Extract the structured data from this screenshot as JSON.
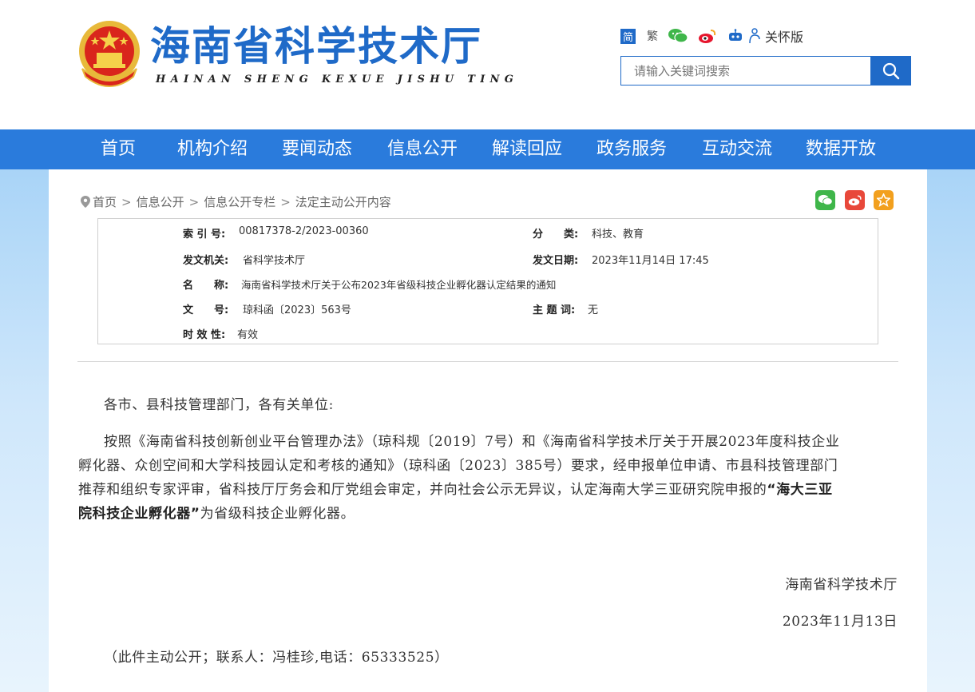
{
  "header": {
    "title": "海南省科学技术厅",
    "pinyin": "HAINAN SHENG KEXUE JISHU TING",
    "tools": {
      "simplified": "简",
      "traditional": "繁",
      "care": "关怀版"
    },
    "search_placeholder": "请输入关键词搜索"
  },
  "nav": [
    "首页",
    "机构介绍",
    "要闻动态",
    "信息公开",
    "解读回应",
    "政务服务",
    "互动交流",
    "数据开放"
  ],
  "breadcrumb": [
    "首页",
    "信息公开",
    "信息公开专栏",
    "法定主动公开内容"
  ],
  "meta": {
    "index_label": "索 引 号:",
    "index_value": "00817378-2/2023-00360",
    "category_label": "分　　类:",
    "category_value": "科技、教育",
    "issuer_label": "发文机关:",
    "issuer_value": "省科学技术厅",
    "date_label": "发文日期:",
    "date_value": "2023年11月14日 17:45",
    "name_label": "名　　称:",
    "name_value": "海南省科学技术厅关于公布2023年省级科技企业孵化器认定结果的通知",
    "docno_label": "文　　号:",
    "docno_value": "琼科函〔2023〕563号",
    "subject_label": "主 题 词:",
    "subject_value": "无",
    "validity_label": "时 效 性:",
    "validity_value": "有效"
  },
  "article": {
    "salutation": "各市、县科技管理部门，各有关单位:",
    "p1_line1": "按照《海南省科技创新创业平台管理办法》（琼科规〔2019〕7号）和《海南省科学技术厅关于开展2023年度科技企业",
    "p1_line2": "孵化器、众创空间和大学科技园认定和考核的通知》（琼科函〔2023〕385号）要求，经申报单位申请、市县科技管理部门",
    "p1_line3_pre": "推荐和组织专家评审，省科技厅厅务会和厅党组会审定，并向社会公示无异议，认定海南大学三亚研究院申报的",
    "p1_bold_a": "“海大三亚",
    "p1_bold_b": "院科技企业孵化器”",
    "p1_line4_post": "为省级科技企业孵化器。",
    "signature": "海南省科学技术厅",
    "sign_date": "2023年11月13日",
    "note": "（此件主动公开；联系人：冯桂珍,电话：65333525）"
  },
  "colors": {
    "brand_blue": "#1f6ac8",
    "nav_blue": "#2a7bdc"
  }
}
